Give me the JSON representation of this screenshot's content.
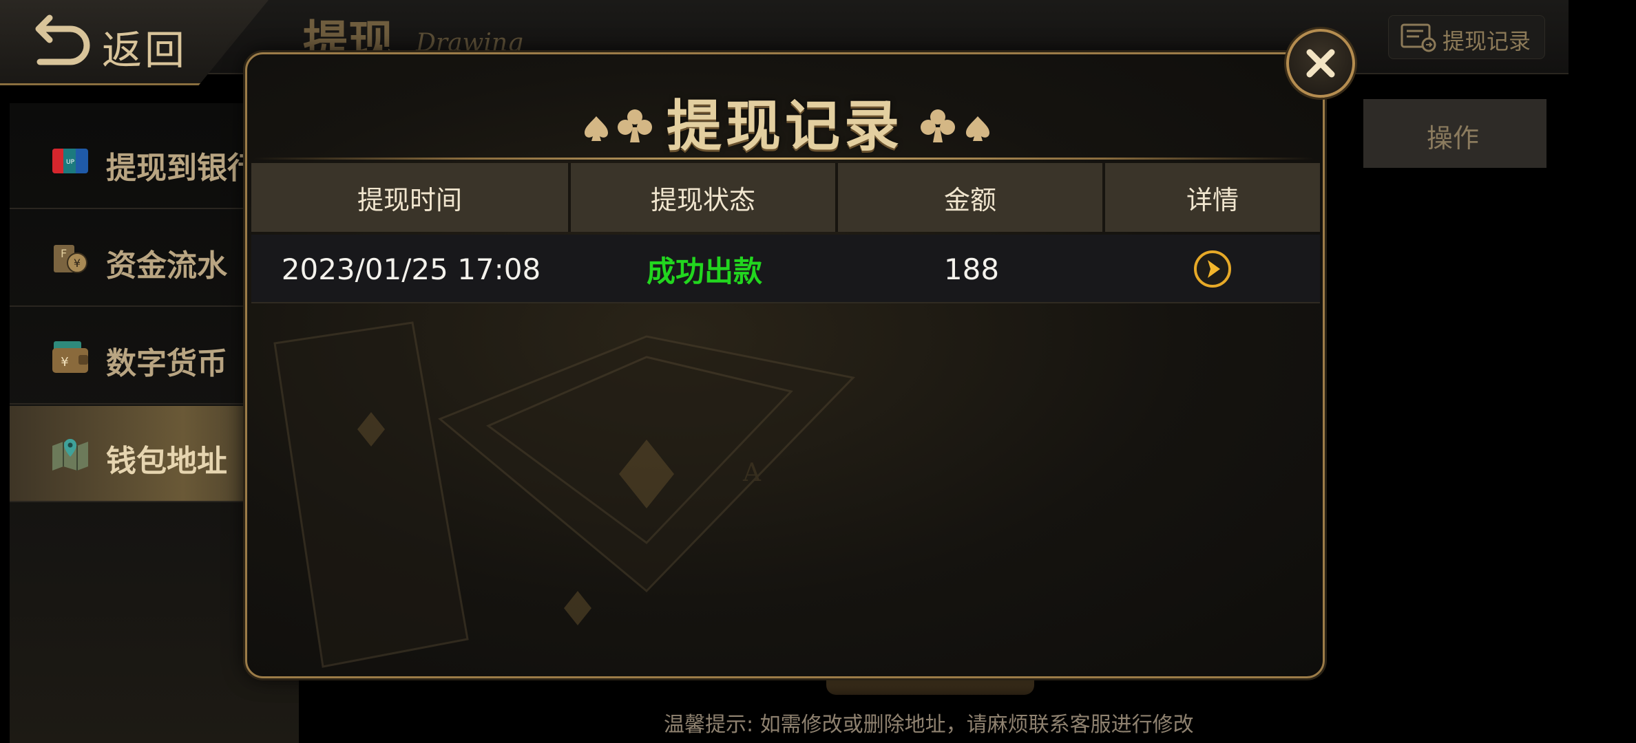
{
  "header": {
    "back_label": "返回",
    "title": "提现",
    "title_en": "Drawing",
    "record_button_label": "提现记录"
  },
  "sidebar": {
    "items": [
      {
        "label": "提现到银行",
        "icon": "unionpay-card-icon",
        "active": false
      },
      {
        "label": "资金流水",
        "icon": "fund-flow-icon",
        "active": false
      },
      {
        "label": "数字货币",
        "icon": "wallet-yen-icon",
        "active": false
      },
      {
        "label": "钱包地址",
        "icon": "map-location-icon",
        "active": true
      }
    ]
  },
  "background_table": {
    "ops_column_label": "操作"
  },
  "hint": "温馨提示: 如需修改或删除地址，请麻烦联系客服进行修改",
  "modal": {
    "title": "提现记录",
    "columns": [
      "提现时间",
      "提现状态",
      "金额",
      "详情"
    ],
    "rows": [
      {
        "time": "2023/01/25 17:08",
        "status": "成功出款",
        "amount": "188",
        "detail_icon": "arrow-right-circle-icon"
      }
    ],
    "colors": {
      "status_success": "#22d61f",
      "accent_gold": "#c9a86a"
    }
  }
}
